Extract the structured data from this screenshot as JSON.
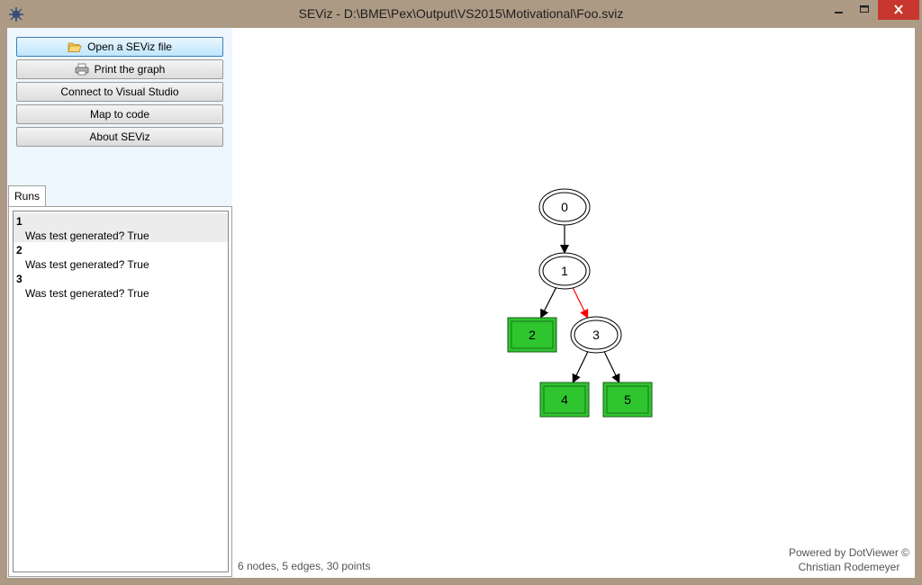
{
  "window": {
    "title": "SEViz - D:\\BME\\Pex\\Output\\VS2015\\Motivational\\Foo.sviz"
  },
  "sidebar": {
    "buttons": [
      {
        "label": "Open a SEViz file",
        "icon": "folder-icon"
      },
      {
        "label": "Print the graph",
        "icon": "printer-icon"
      },
      {
        "label": "Connect to Visual Studio"
      },
      {
        "label": "Map to code"
      },
      {
        "label": "About SEViz"
      }
    ],
    "tab_label": "Runs",
    "runs": [
      {
        "number": "1",
        "description": "Was test generated? True"
      },
      {
        "number": "2",
        "description": "Was test generated? True"
      },
      {
        "number": "3",
        "description": "Was test generated? True"
      }
    ]
  },
  "graph": {
    "nodes": [
      {
        "id": "0",
        "shape": "double-ellipse",
        "fill": "#ffffff"
      },
      {
        "id": "1",
        "shape": "double-ellipse",
        "fill": "#ffffff"
      },
      {
        "id": "2",
        "shape": "double-box",
        "fill": "#2ec52e"
      },
      {
        "id": "3",
        "shape": "double-ellipse",
        "fill": "#ffffff"
      },
      {
        "id": "4",
        "shape": "double-box",
        "fill": "#2ec52e"
      },
      {
        "id": "5",
        "shape": "double-box",
        "fill": "#2ec52e"
      }
    ],
    "edges": [
      {
        "from": "0",
        "to": "1",
        "color": "#000000"
      },
      {
        "from": "1",
        "to": "2",
        "color": "#000000"
      },
      {
        "from": "1",
        "to": "3",
        "color": "#ff0000"
      },
      {
        "from": "3",
        "to": "4",
        "color": "#000000"
      },
      {
        "from": "3",
        "to": "5",
        "color": "#000000"
      }
    ]
  },
  "status": {
    "summary": "6 nodes, 5 edges, 30 points",
    "credit_line1": "Powered by DotViewer ©",
    "credit_line2": "Christian Rodemeyer"
  }
}
